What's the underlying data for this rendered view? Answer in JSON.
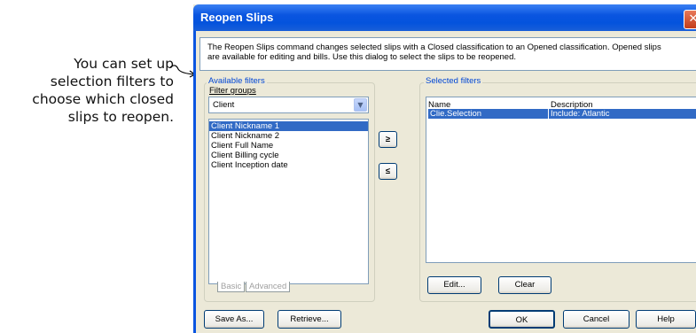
{
  "callout": {
    "lines": [
      "You can set up",
      "selection filters to",
      "choose which closed",
      "slips to reopen."
    ]
  },
  "dialog": {
    "title": "Reopen Slips",
    "close_glyph": "✕",
    "description_line1": "The Reopen Slips command changes selected slips with a Closed classification to an Opened classification. Opened slips",
    "description_line2": "are available for editing and bills. Use this dialog to select the slips to be reopened."
  },
  "available": {
    "group_label": "Available filters",
    "filter_groups_label": "Filter groups",
    "combo_value": "Client",
    "items": [
      {
        "label": "Client Nickname 1",
        "selected": true
      },
      {
        "label": "Client Nickname 2",
        "selected": false
      },
      {
        "label": "Client Full Name",
        "selected": false
      },
      {
        "label": "Client Billing cycle",
        "selected": false
      },
      {
        "label": "Client Inception date",
        "selected": false
      }
    ],
    "tabs": [
      "Basic",
      "Advanced"
    ]
  },
  "arrows": {
    "add": "≥",
    "remove": "≤"
  },
  "selected": {
    "group_label": "Selected filters",
    "col_name": "Name",
    "col_description": "Description",
    "rows": [
      {
        "name": "Clie.Selection",
        "description": "Include: Atlantic"
      }
    ],
    "edit_label": "Edit...",
    "clear_label": "Clear"
  },
  "footer": {
    "save_as_label": "Save As...",
    "retrieve_label": "Retrieve...",
    "ok_label": "OK",
    "cancel_label": "Cancel",
    "help_label": "Help"
  },
  "colors": {
    "title_bar": "#0a55e0",
    "selection": "#316ac5",
    "dialog_bg": "#ece9d8",
    "group_label": "#0046d5"
  }
}
